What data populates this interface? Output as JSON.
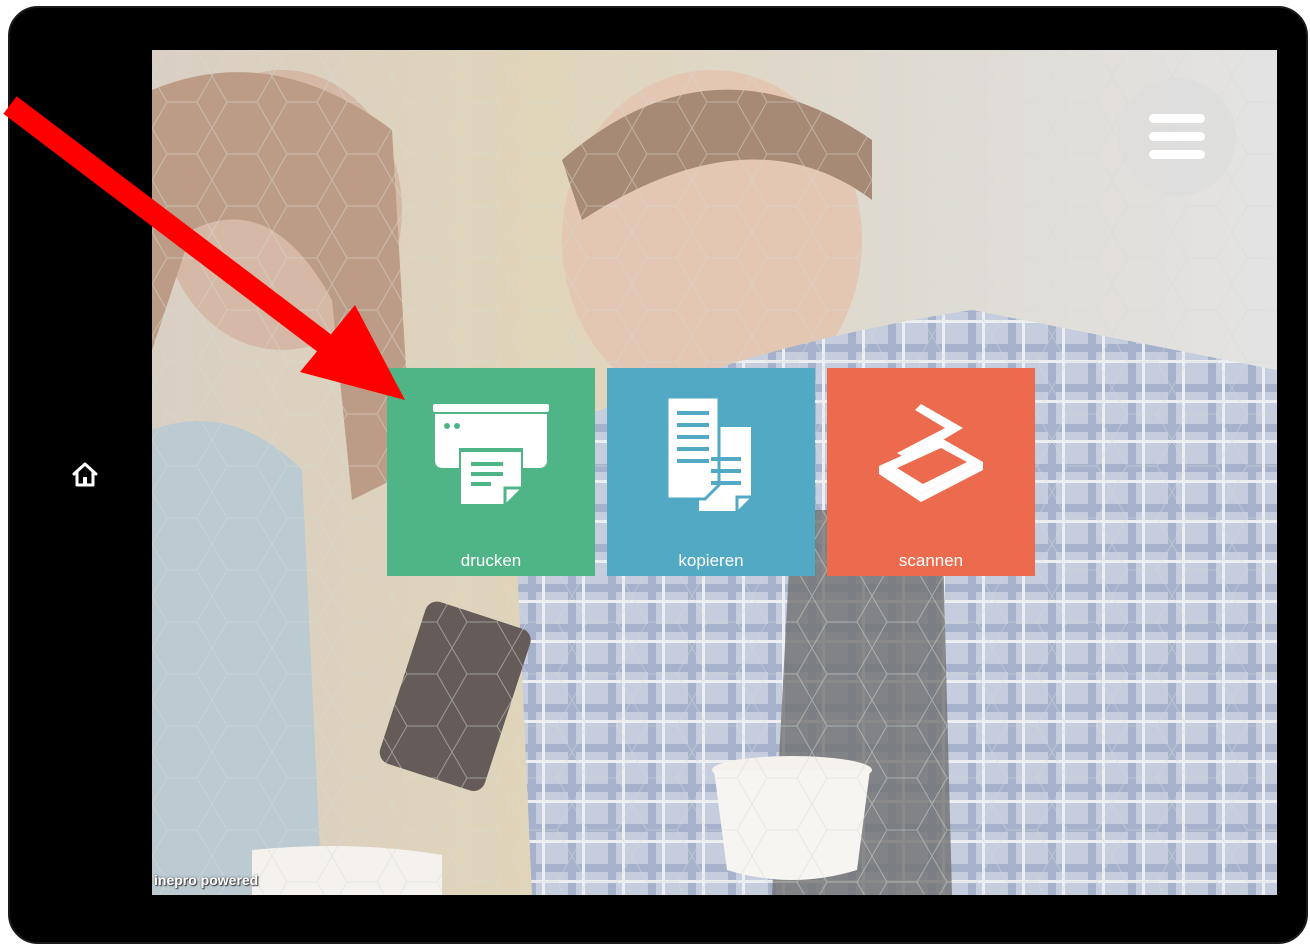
{
  "device": {
    "home_icon": "home-icon",
    "frame_color": "#000000"
  },
  "screen": {
    "menu_icon": "hamburger-menu-icon",
    "footer_brand": "inepro powered"
  },
  "tiles": [
    {
      "label": "drucken",
      "icon": "printer-icon",
      "color": "#4fb587"
    },
    {
      "label": "kopieren",
      "icon": "copy-documents-icon",
      "color": "#52a9c4"
    },
    {
      "label": "scannen",
      "icon": "scanner-icon",
      "color": "#ec6b4e"
    }
  ],
  "annotation": {
    "arrow_color": "#ff0000",
    "points_to": "drucken"
  }
}
